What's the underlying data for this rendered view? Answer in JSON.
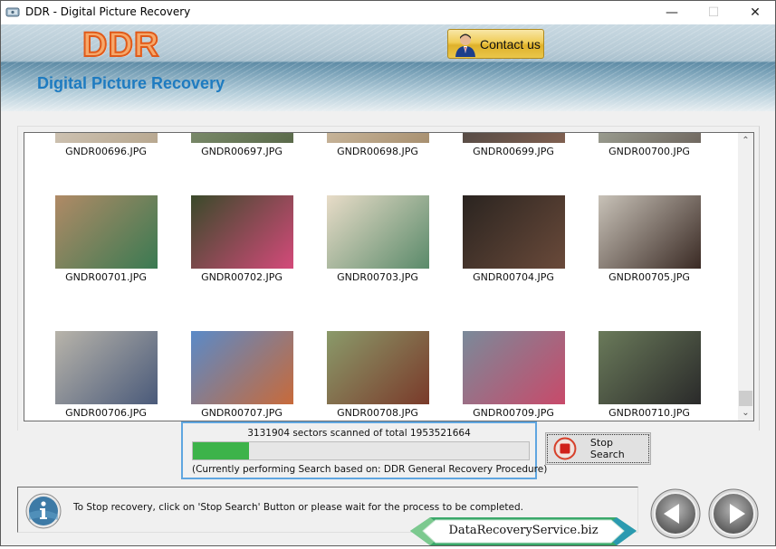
{
  "window": {
    "title": "DDR - Digital Picture Recovery",
    "controls": {
      "minimize": "—",
      "maximize": "☐",
      "close": "✕"
    }
  },
  "header": {
    "logo_text": "DDR",
    "product_title": "Digital Picture Recovery",
    "contact_button_label": "Contact us",
    "contact_icon": "user-support-icon"
  },
  "gallery": {
    "items": [
      {
        "filename": "GNDR00696.JPG",
        "colors": [
          "#d9d0c4",
          "#b8a890"
        ]
      },
      {
        "filename": "GNDR00697.JPG",
        "colors": [
          "#8a9a7a",
          "#5a6a4a"
        ]
      },
      {
        "filename": "GNDR00698.JPG",
        "colors": [
          "#d8c8b0",
          "#a89070"
        ]
      },
      {
        "filename": "GNDR00699.JPG",
        "colors": [
          "#404040",
          "#806050"
        ]
      },
      {
        "filename": "GNDR00700.JPG",
        "colors": [
          "#b0b8a8",
          "#706860"
        ]
      },
      {
        "filename": "GNDR00701.JPG",
        "colors": [
          "#b08a66",
          "#3a7a52"
        ]
      },
      {
        "filename": "GNDR00702.JPG",
        "colors": [
          "#3a4a2a",
          "#d44a7a"
        ]
      },
      {
        "filename": "GNDR00703.JPG",
        "colors": [
          "#e8dcc8",
          "#5a8a6a"
        ]
      },
      {
        "filename": "GNDR00704.JPG",
        "colors": [
          "#2a2420",
          "#6a4a3a"
        ]
      },
      {
        "filename": "GNDR00705.JPG",
        "colors": [
          "#c8c2b8",
          "#3a2a24"
        ]
      },
      {
        "filename": "GNDR00706.JPG",
        "colors": [
          "#b8b4aa",
          "#4a5a7a"
        ]
      },
      {
        "filename": "GNDR00707.JPG",
        "colors": [
          "#5a8ac8",
          "#c86a3a"
        ]
      },
      {
        "filename": "GNDR00708.JPG",
        "colors": [
          "#8a9a6a",
          "#7a3a2a"
        ]
      },
      {
        "filename": "GNDR00709.JPG",
        "colors": [
          "#7a8a9a",
          "#c84a6a"
        ]
      },
      {
        "filename": "GNDR00710.JPG",
        "colors": [
          "#6a7a5a",
          "#2a2a2a"
        ]
      }
    ],
    "scroll_up_icon": "⌃",
    "scroll_down_icon": "⌄"
  },
  "progress": {
    "status_text": "3131904 sectors scanned of total 1953521664",
    "percent": 16.6,
    "procedure_text": "(Currently performing Search based on:  DDR General Recovery Procedure)",
    "fill_color": "#3db34a"
  },
  "stop_button": {
    "label": "Stop Search",
    "icon": "stop-icon"
  },
  "footer": {
    "info_text": "To Stop recovery, click on 'Stop Search' Button or please wait for the process to be completed.",
    "brand_text": "DataRecoveryService.biz",
    "back_icon": "back-arrow-icon",
    "next_icon": "next-arrow-icon"
  }
}
